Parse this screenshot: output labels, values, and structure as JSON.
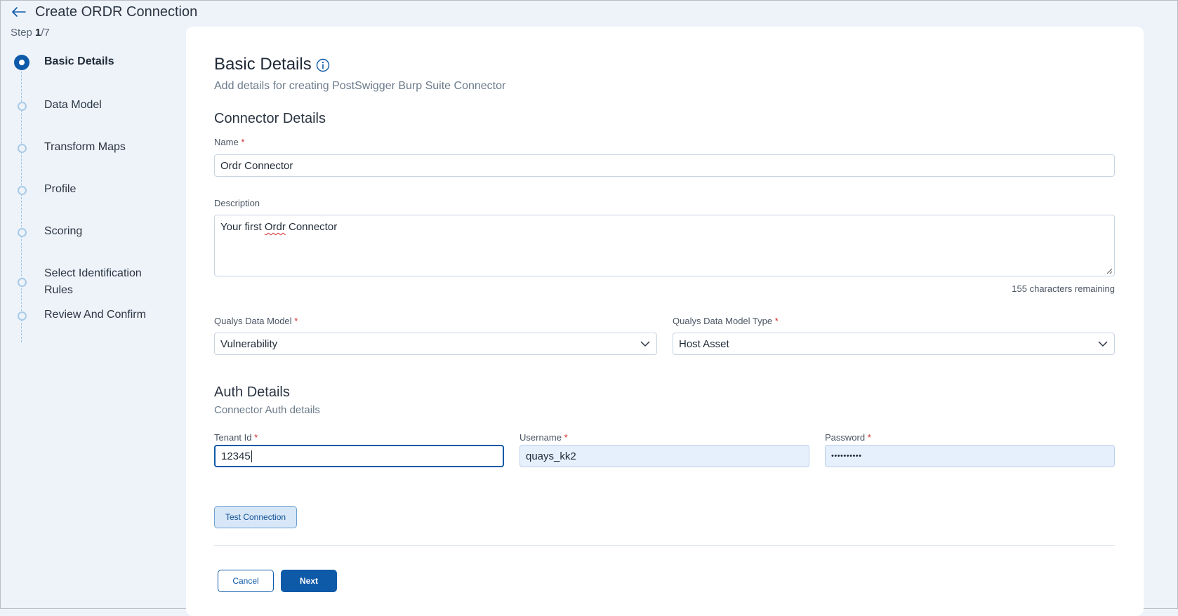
{
  "header": {
    "title": "Create ORDR Connection",
    "step_prefix": "Step ",
    "step_current": "1",
    "step_total": "/7"
  },
  "stepper": {
    "steps": [
      {
        "label": "Basic Details",
        "active": true
      },
      {
        "label": "Data Model",
        "active": false
      },
      {
        "label": "Transform Maps",
        "active": false
      },
      {
        "label": "Profile",
        "active": false
      },
      {
        "label": "Scoring",
        "active": false
      },
      {
        "label": "Select Identification Rules",
        "active": false
      },
      {
        "label": "Review And Confirm",
        "active": false
      }
    ]
  },
  "main": {
    "title": "Basic Details",
    "subtitle": "Add details for creating PostSwigger Burp Suite Connector",
    "connector_section": "Connector Details",
    "name_label": "Name",
    "name_value": "Ordr Connector",
    "description_label": "Description",
    "description_before": "Your first ",
    "description_misspelled": "Ordr",
    "description_after": " Connector",
    "char_remaining": "155 characters remaining",
    "data_model_label": "Qualys Data Model",
    "data_model_value": "Vulnerability",
    "data_model_type_label": "Qualys Data Model Type",
    "data_model_type_value": "Host Asset",
    "auth_section": "Auth Details",
    "auth_subtitle": "Connector Auth details",
    "tenant_label": "Tenant Id",
    "tenant_value": "12345",
    "username_label": "Username",
    "username_value": "quays_kk2",
    "password_label": "Password",
    "password_value": "••••••••••",
    "required_mark": "*",
    "test_connection_label": "Test Connection",
    "cancel_label": "Cancel",
    "next_label": "Next"
  },
  "colors": {
    "primary": "#0e5aa8",
    "background": "#eef3fa",
    "required": "#d12b2b",
    "filled_input": "#e6f0fd"
  },
  "icons": {
    "back": "arrow-left-icon",
    "info": "info-icon",
    "dropdown": "chevron-down-icon"
  }
}
